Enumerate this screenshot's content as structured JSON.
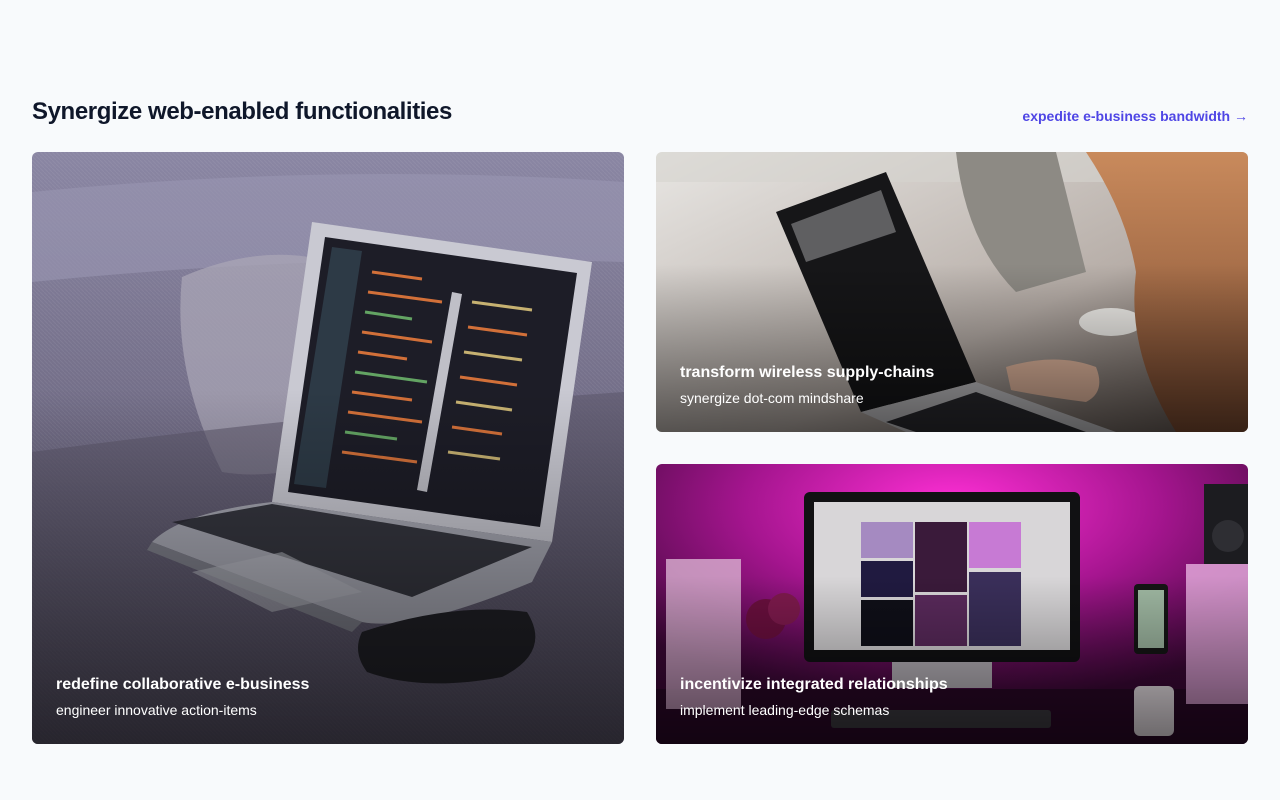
{
  "section": {
    "title": "Synergize web-enabled functionalities",
    "link_label": "expedite e-business bandwidth →"
  },
  "cards": [
    {
      "title": "redefine collaborative e-business",
      "subtitle": "engineer innovative action-items",
      "image": "laptop-code-on-couch"
    },
    {
      "title": "transform wireless supply-chains",
      "subtitle": "synergize dot-com mindshare",
      "image": "person-typing-laptop"
    },
    {
      "title": "incentivize integrated relationships",
      "subtitle": "implement leading-edge schemas",
      "image": "desk-with-imac-magenta-light"
    }
  ],
  "colors": {
    "background": "#f8fafc",
    "heading": "#0f172a",
    "accent": "#4f46e5"
  }
}
